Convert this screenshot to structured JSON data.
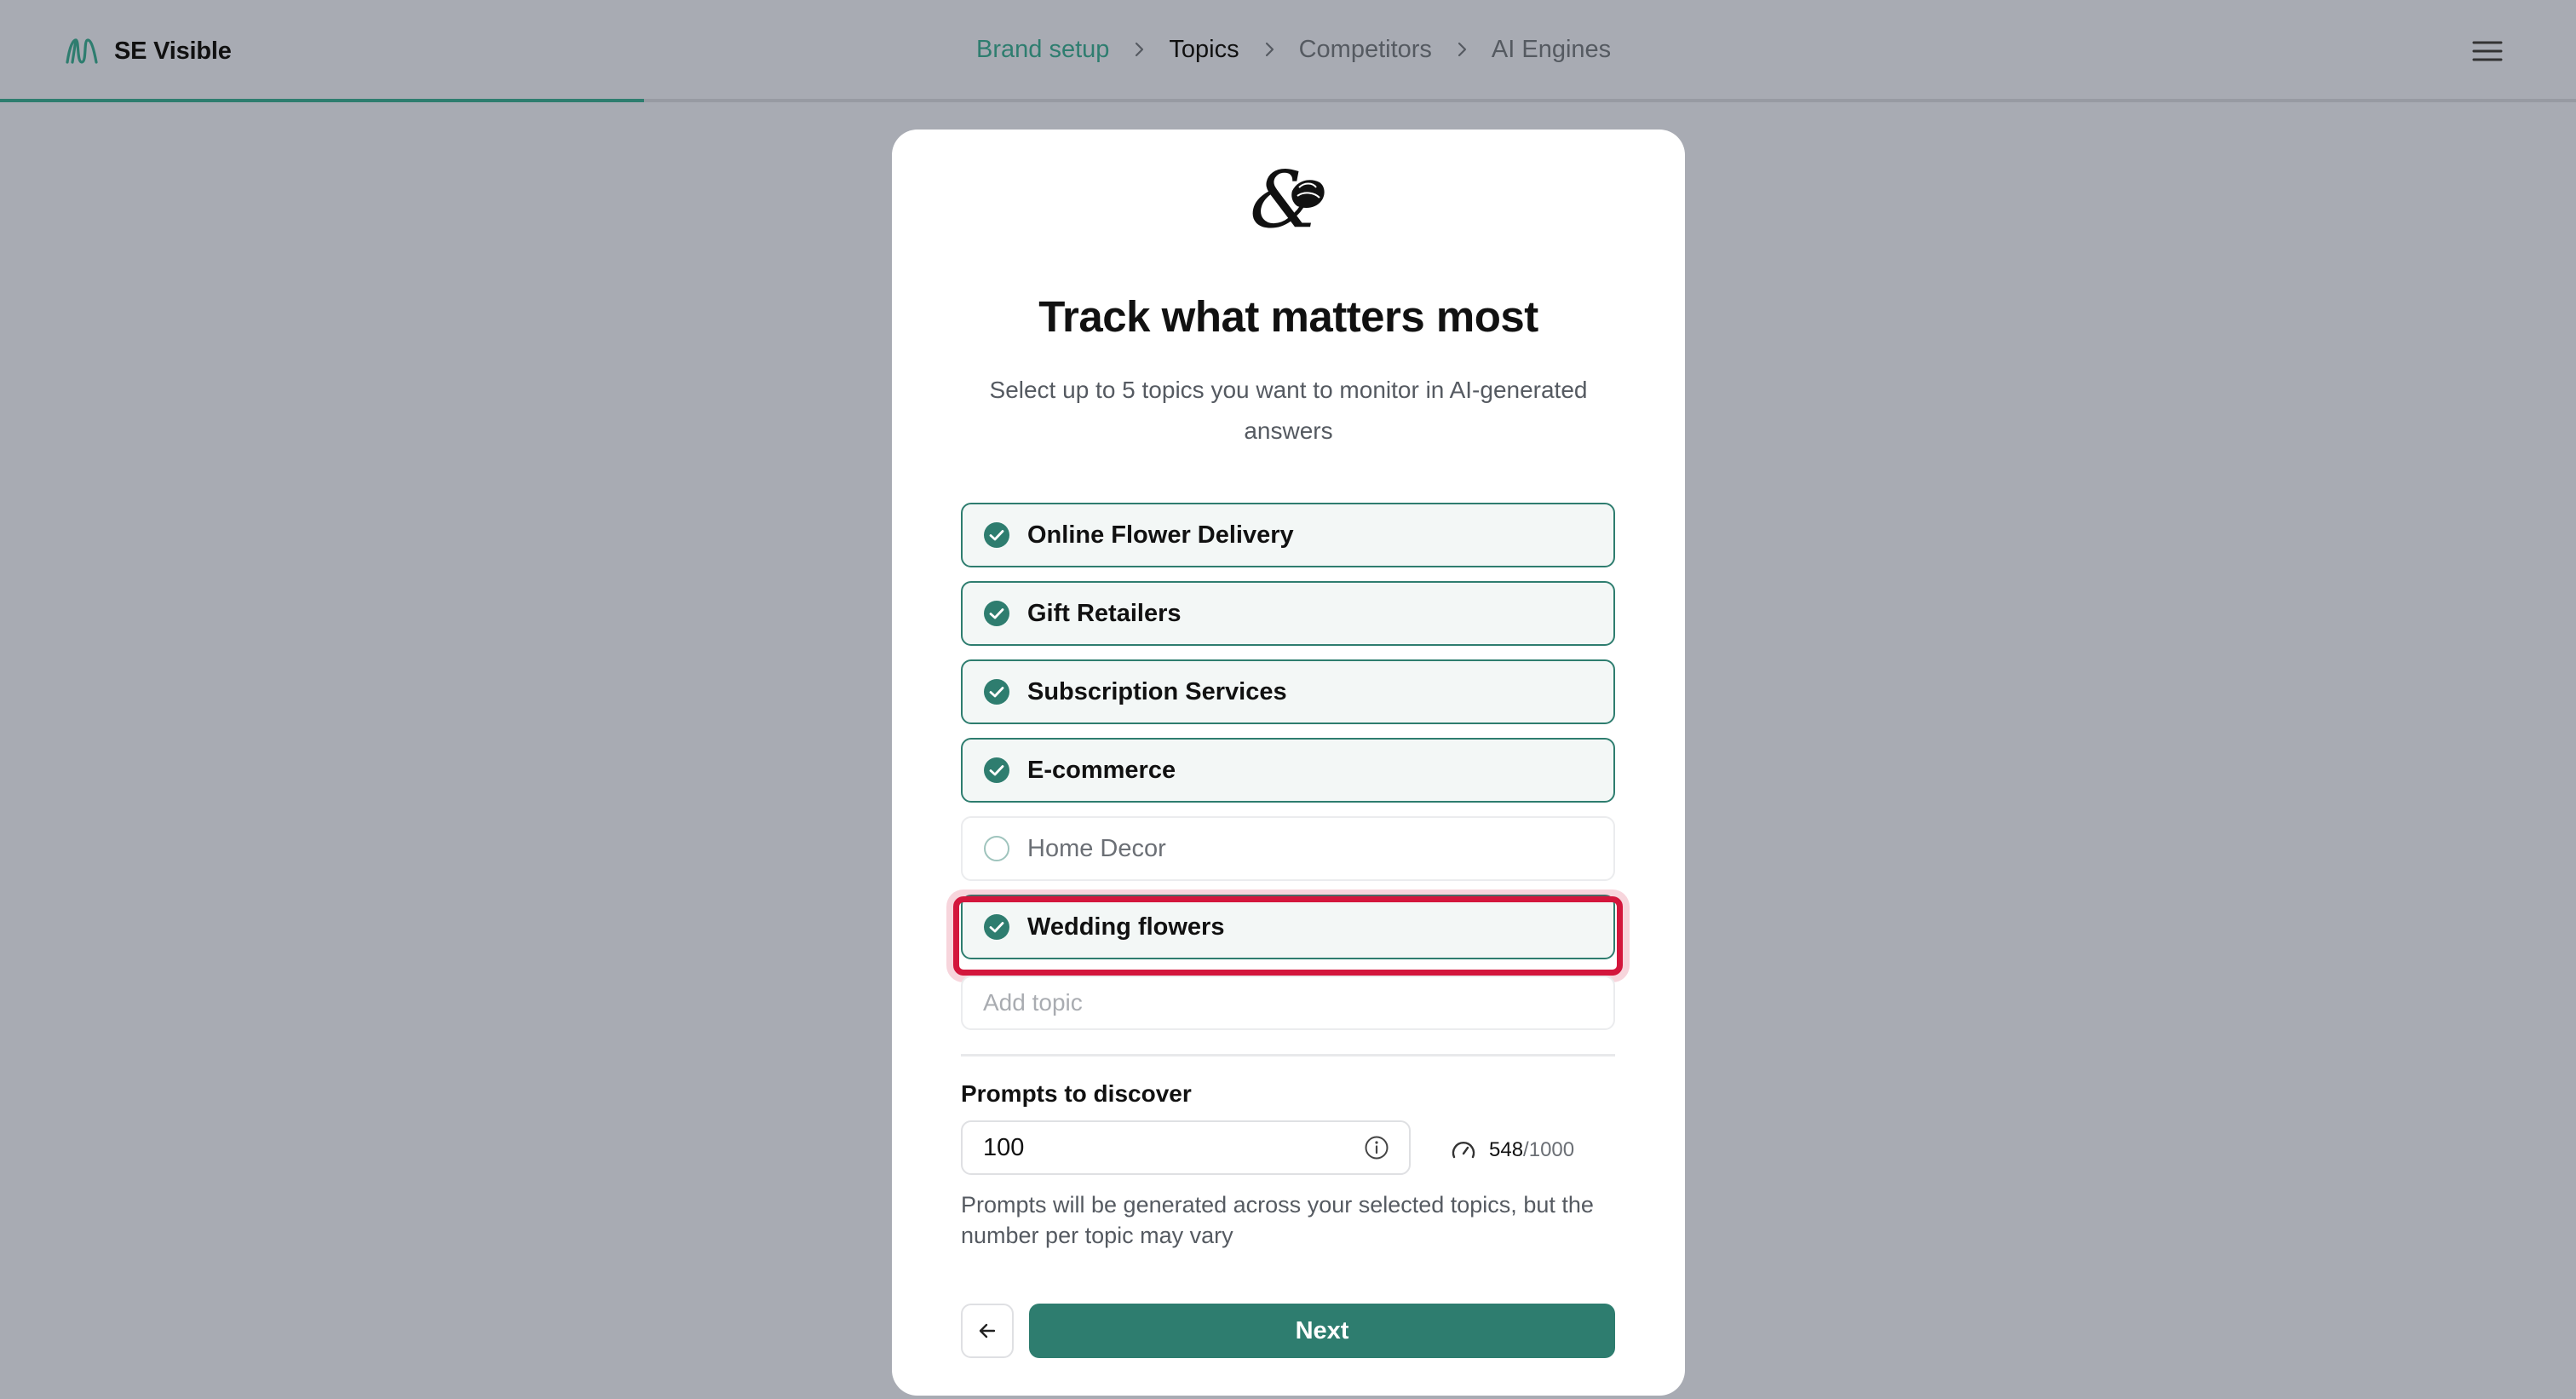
{
  "app": {
    "name": "SE Visible",
    "accent_color": "#2e7d6f",
    "highlight_color": "#d3163c"
  },
  "breadcrumb": {
    "steps": [
      "Brand setup",
      "Topics",
      "Competitors",
      "AI Engines"
    ],
    "current_step": "Topics",
    "progress_fraction": 0.25
  },
  "header": {
    "logo_icon": "se-visible-logo-icon",
    "menu_icon": "hamburger-menu-icon"
  },
  "card": {
    "brand_logo_icon": "ampersand-flower-logo-icon",
    "title": "Track what matters most",
    "subtitle": "Select up to 5 topics you want to monitor in AI-generated answers"
  },
  "topics": [
    {
      "label": "Online Flower Delivery",
      "checked": true
    },
    {
      "label": "Gift Retailers",
      "checked": true
    },
    {
      "label": "Subscription Services",
      "checked": true
    },
    {
      "label": "E-commerce",
      "checked": true
    },
    {
      "label": "Home Decor",
      "checked": false
    },
    {
      "label": "Wedding flowers",
      "checked": true,
      "highlighted": true
    }
  ],
  "add_topic": {
    "placeholder": "Add topic",
    "value": ""
  },
  "prompts": {
    "label": "Prompts to discover",
    "value": "100",
    "quota_used": "548",
    "quota_total": "/1000",
    "help_text": "Prompts will be generated across your selected topics, but the number per topic may vary"
  },
  "actions": {
    "back_icon": "arrow-left-icon",
    "next_label": "Next"
  }
}
